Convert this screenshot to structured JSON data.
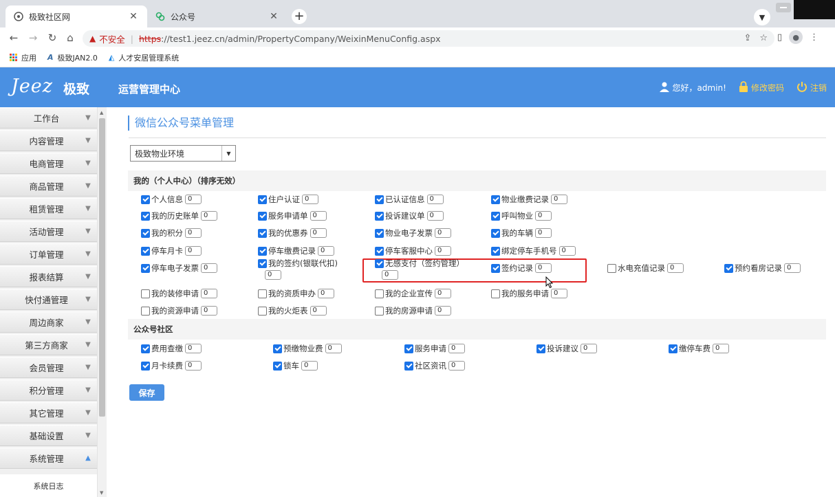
{
  "browser": {
    "tabs": [
      {
        "title": "极致社区网",
        "active": true
      },
      {
        "title": "公众号",
        "active": false
      }
    ],
    "address": {
      "security_label": "不安全",
      "scheme": "https",
      "rest": "://test1.jeez.cn/admin/PropertyCompany/WeixinMenuConfig.aspx"
    },
    "bookmarks": [
      {
        "label": "应用",
        "icon": "apps-grid-icon"
      },
      {
        "label": "极致JAN2.0",
        "icon": "jan-logo-icon"
      },
      {
        "label": "人才安居管理系统",
        "icon": "house-logo-icon"
      }
    ]
  },
  "header": {
    "logo_text": "Jeez",
    "logo_cn": "极致",
    "system_title": "运营管理中心",
    "greeting": "您好，admin!",
    "change_password": "修改密码",
    "logout": "注销",
    "bg_color": "#4a90e2"
  },
  "sidebar": {
    "items": [
      {
        "label": "工作台",
        "expanded": false
      },
      {
        "label": "内容管理",
        "expanded": false
      },
      {
        "label": "电商管理",
        "expanded": false
      },
      {
        "label": "商品管理",
        "expanded": false
      },
      {
        "label": "租赁管理",
        "expanded": false
      },
      {
        "label": "活动管理",
        "expanded": false
      },
      {
        "label": "订单管理",
        "expanded": false
      },
      {
        "label": "报表结算",
        "expanded": false
      },
      {
        "label": "快付通管理",
        "expanded": false
      },
      {
        "label": "周边商家",
        "expanded": false
      },
      {
        "label": "第三方商家",
        "expanded": false
      },
      {
        "label": "会员管理",
        "expanded": false
      },
      {
        "label": "积分管理",
        "expanded": false
      },
      {
        "label": "其它管理",
        "expanded": false
      },
      {
        "label": "基础设置",
        "expanded": false
      },
      {
        "label": "系统管理",
        "expanded": true
      }
    ],
    "sub_item": "系统日志"
  },
  "main": {
    "page_title": "微信公众号菜单管理",
    "environment": {
      "selected": "极致物业环境"
    },
    "section_personal": {
      "title": "我的（个人中心）（排序无效）",
      "rows": [
        [
          {
            "label": "个人信息",
            "checked": true,
            "order": "0"
          },
          {
            "label": "住户认证",
            "checked": true,
            "order": "0"
          },
          {
            "label": "已认证信息",
            "checked": true,
            "order": "0"
          },
          {
            "label": "物业缴费记录",
            "checked": true,
            "order": "0"
          }
        ],
        [
          {
            "label": "我的历史账单",
            "checked": true,
            "order": "0"
          },
          {
            "label": "服务申请单",
            "checked": true,
            "order": "0"
          },
          {
            "label": "投诉建议单",
            "checked": true,
            "order": "0"
          },
          {
            "label": "呼叫物业",
            "checked": true,
            "order": "0"
          }
        ],
        [
          {
            "label": "我的积分",
            "checked": true,
            "order": "0"
          },
          {
            "label": "我的优惠券",
            "checked": true,
            "order": "0"
          },
          {
            "label": "物业电子发票",
            "checked": true,
            "order": "0"
          },
          {
            "label": "我的车辆",
            "checked": true,
            "order": "0"
          }
        ],
        [
          {
            "label": "停车月卡",
            "checked": true,
            "order": "0"
          },
          {
            "label": "停车缴费记录",
            "checked": true,
            "order": "0"
          },
          {
            "label": "停车客服中心",
            "checked": true,
            "order": "0"
          },
          {
            "label": "绑定停车手机号",
            "checked": true,
            "order": "0"
          }
        ],
        [
          {
            "label": "停车电子发票",
            "checked": true,
            "order": "0"
          },
          {
            "label": "我的签约(银联代扣)",
            "checked": true,
            "order": "0"
          },
          {
            "label": "无感支付（签约管理）",
            "checked": true,
            "order": "0"
          },
          {
            "label": "签约记录",
            "checked": true,
            "order": "0"
          },
          {
            "label": "水电充值记录",
            "checked": false,
            "order": "0"
          },
          {
            "label": "预约看房记录",
            "checked": true,
            "order": "0"
          }
        ],
        [
          {
            "label": "我的装修申请",
            "checked": false,
            "order": "0"
          },
          {
            "label": "我的资质申办",
            "checked": false,
            "order": "0"
          },
          {
            "label": "我的企业宣传",
            "checked": false,
            "order": "0"
          },
          {
            "label": "我的服务申请",
            "checked": false,
            "order": "0"
          }
        ],
        [
          {
            "label": "我的资源申请",
            "checked": false,
            "order": "0"
          },
          {
            "label": "我的火炬表",
            "checked": false,
            "order": "0"
          },
          {
            "label": "我的房源申请",
            "checked": false,
            "order": "0"
          }
        ]
      ]
    },
    "section_community": {
      "title": "公众号社区",
      "rows": [
        [
          {
            "label": "费用查缴",
            "checked": true,
            "order": "0"
          },
          {
            "label": "预缴物业费",
            "checked": true,
            "order": "0"
          },
          {
            "label": "服务申请",
            "checked": true,
            "order": "0"
          },
          {
            "label": "投诉建议",
            "checked": true,
            "order": "0"
          },
          {
            "label": "缴停车费",
            "checked": true,
            "order": "0"
          }
        ],
        [
          {
            "label": "月卡续费",
            "checked": true,
            "order": "0"
          },
          {
            "label": "锁车",
            "checked": true,
            "order": "0"
          },
          {
            "label": "社区资讯",
            "checked": true,
            "order": "0"
          }
        ]
      ]
    },
    "save_label": "保存",
    "highlight_color": "#e02424"
  }
}
